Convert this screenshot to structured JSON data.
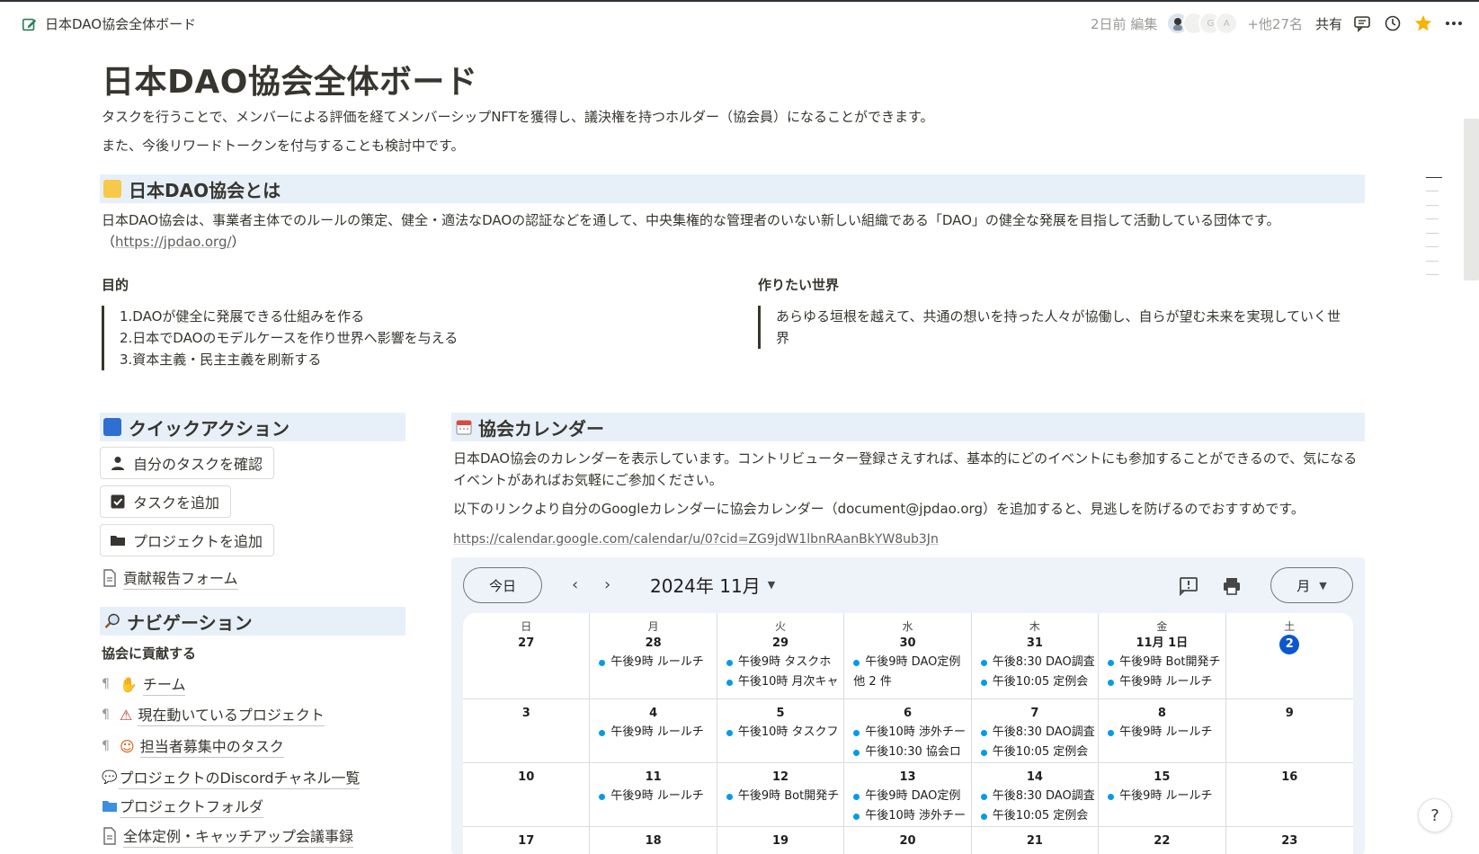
{
  "topbar": {
    "breadcrumb_title": "日本DAO協会全体ボード",
    "edited": "2日前 編集",
    "avatars": [
      "",
      "",
      "G",
      "A"
    ],
    "others": "+他27名",
    "share": "共有"
  },
  "page": {
    "title": "日本DAO協会全体ボード",
    "intro1": "タスクを行うことで、メンバーによる評価を経てメンバーシップNFTを獲得し、議決権を持つホルダー（協会員）になることができます。",
    "intro2": "また、今後リワードトークンを付与することも検討中です。"
  },
  "about": {
    "heading": "日本DAO協会とは",
    "body": "日本DAO協会は、事業者主体でのルールの策定、健全・適法なDAOの認証などを通して、中央集権的な管理者のいない新しい組織である「DAO」の健全な発展を目指して活動している団体です。",
    "link_open": "（",
    "link": "https://jpdao.org/",
    "link_close": "）",
    "purpose_heading": "目的",
    "purpose_items": [
      "1.DAOが健全に発展できる仕組みを作る",
      "2.日本でDAOのモデルケースを作り世界へ影響を与える",
      "3.資本主義・民主主義を刷新する"
    ],
    "world_heading": "作りたい世界",
    "world_body": "あらゆる垣根を越えて、共通の想いを持った人々が協働し、自らが望む未来を実現していく世界"
  },
  "quick": {
    "heading": "クイックアクション",
    "btn_my_tasks": "自分のタスクを確認",
    "btn_add_task": "タスクを追加",
    "btn_add_project": "プロジェクトを追加",
    "form_link": "貢献報告フォーム"
  },
  "nav": {
    "heading": "ナビゲーション",
    "sub": "協会に貢献する",
    "team": "チーム",
    "projects": "現在動いているプロジェクト",
    "tasks": "担当者募集中のタスク",
    "discord": "プロジェクトのDiscordチャネル一覧",
    "folder": "プロジェクトフォルダ",
    "minutes": "全体定例・キャッチアップ会議事録"
  },
  "calendar": {
    "heading": "協会カレンダー",
    "desc1": "日本DAO協会のカレンダーを表示しています。コントリビューター登録さえすれば、基本的にどのイベントにも参加することができるので、気になるイベントがあればお気軽にご参加ください。",
    "desc2": "以下のリンクより自分のGoogleカレンダーに協会カレンダー（document@jpdao.org）を追加すると、見逃しを防げるのでおすすめです。",
    "link": "https://calendar.google.com/calendar/u/0?cid=ZG9jdW1lbnRAanBkYW8ub3Jn",
    "today": "今日",
    "month": "2024年 11月",
    "view": "月",
    "weekdays": [
      "日",
      "月",
      "火",
      "水",
      "木",
      "金",
      "土"
    ],
    "weeks": [
      [
        {
          "d": "27",
          "events": []
        },
        {
          "d": "28",
          "events": [
            "午後9時 ルールチ"
          ]
        },
        {
          "d": "29",
          "events": [
            "午後9時 タスクホ",
            "午後10時 月次キャ"
          ]
        },
        {
          "d": "30",
          "events": [
            "午後9時 DAO定例"
          ],
          "more": "他 2 件"
        },
        {
          "d": "31",
          "events": [
            "午後8:30 DAO調査",
            "午後10:05 定例会"
          ]
        },
        {
          "d": "11月 1日",
          "events": [
            "午後9時 Bot開発チ",
            "午後9時 ルールチ"
          ]
        },
        {
          "d": "2",
          "today": true,
          "events": []
        }
      ],
      [
        {
          "d": "3",
          "events": []
        },
        {
          "d": "4",
          "events": [
            "午後9時 ルールチ"
          ]
        },
        {
          "d": "5",
          "events": [
            "午後10時 タスクフ"
          ]
        },
        {
          "d": "6",
          "events": [
            "午後10時 渉外チー",
            "午後10:30 協会ロ"
          ]
        },
        {
          "d": "7",
          "events": [
            "午後8:30 DAO調査",
            "午後10:05 定例会"
          ]
        },
        {
          "d": "8",
          "events": [
            "午後9時 ルールチ"
          ]
        },
        {
          "d": "9",
          "events": []
        }
      ],
      [
        {
          "d": "10",
          "events": []
        },
        {
          "d": "11",
          "events": [
            "午後9時 ルールチ"
          ]
        },
        {
          "d": "12",
          "events": [
            "午後9時 Bot開発チ"
          ]
        },
        {
          "d": "13",
          "events": [
            "午後9時 DAO定例",
            "午後10時 渉外チー"
          ]
        },
        {
          "d": "14",
          "events": [
            "午後8:30 DAO調査",
            "午後10:05 定例会"
          ]
        },
        {
          "d": "15",
          "events": [
            "午後9時 ルールチ"
          ]
        },
        {
          "d": "16",
          "events": []
        }
      ],
      [
        {
          "d": "17",
          "events": []
        },
        {
          "d": "18",
          "events": []
        },
        {
          "d": "19",
          "events": []
        },
        {
          "d": "20",
          "events": []
        },
        {
          "d": "21",
          "events": []
        },
        {
          "d": "22",
          "events": []
        },
        {
          "d": "23",
          "events": []
        }
      ]
    ]
  },
  "help": "?",
  "colors": {
    "heading_bg": "#e7f0f8",
    "event_dot": "#039be5",
    "today_circle": "#0b57d0",
    "star": "#f4b400"
  },
  "icons": [
    "edit-page-icon",
    "comment-icon",
    "history-icon",
    "star-icon",
    "more-icon",
    "person-icon",
    "checkbox-icon",
    "folder-icon",
    "document-icon",
    "calendar-icon",
    "search-icon",
    "handshake-icon",
    "print-icon",
    "feedback-icon"
  ]
}
